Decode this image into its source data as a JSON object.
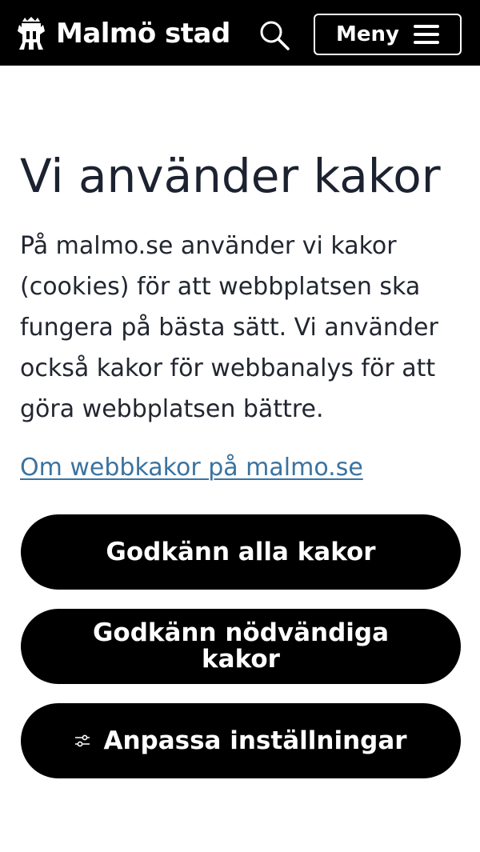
{
  "header": {
    "logo_text": "Malmö stad",
    "logo_icon": "malmo-griffin-crest",
    "search_icon": "search-icon",
    "menu_label": "Meny",
    "menu_icon": "hamburger-icon",
    "background": "#000000"
  },
  "main": {
    "title": "Vi använder kakor",
    "intro": "På malmo.se använder vi kakor (cookies) för att webbplatsen ska fungera på bästa sätt. Vi använder också kakor för webbanalys för att göra webbplatsen bättre.",
    "info_link": "Om webbkakor på malmo.se",
    "link_color": "#3a73a0"
  },
  "buttons": {
    "accept_all": "Godkänn alla kakor",
    "accept_necessary": "Godkänn nödvändiga kakor",
    "customize": "Anpassa inställningar",
    "customize_icon": "sliders-icon",
    "background": "#000000",
    "text_color": "#ffffff"
  }
}
